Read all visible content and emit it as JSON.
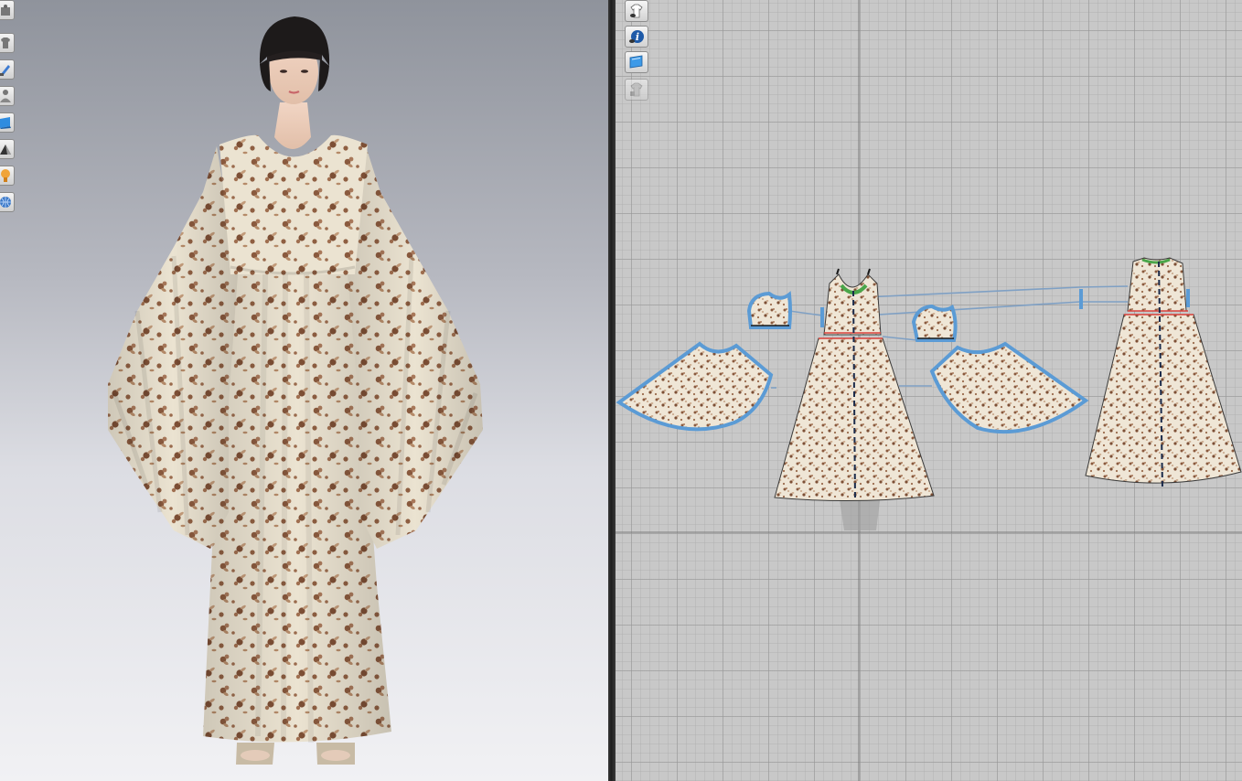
{
  "app": {
    "viewport_3d": {
      "toolbar": [
        {
          "icon": "avatar-display-icon",
          "label": ""
        },
        {
          "icon": "garment-display-icon",
          "label": ""
        },
        {
          "icon": "texture-brush-icon",
          "label": ""
        },
        {
          "icon": "avatar-pose-icon",
          "label": ""
        },
        {
          "icon": "fabric-display-icon",
          "label": ""
        },
        {
          "icon": "render-mode-icon",
          "label": ""
        },
        {
          "icon": "stress-map-icon",
          "label": ""
        },
        {
          "icon": "environment-globe-icon",
          "label": ""
        }
      ],
      "garment": {
        "print_base_color": "#ebe3d1",
        "print_flower_color": "#8a5a3e",
        "print_leaf_color": "#b58a68"
      }
    },
    "viewport_2d": {
      "toolbar": [
        {
          "icon": "garment-visibility-icon",
          "enabled": true
        },
        {
          "icon": "info-icon",
          "enabled": true
        },
        {
          "icon": "fabric-texture-icon",
          "enabled": true
        },
        {
          "icon": "garment-lock-icon",
          "enabled": false
        }
      ],
      "colors": {
        "grid_background": "#c8c8c8",
        "seam_highlight": "#5b9bd5",
        "seam_red": "#d9413b",
        "seam_green": "#4aa64a",
        "grain_line": "#1a2a4a"
      },
      "pattern_pieces": [
        "left-sleeve-cap",
        "right-sleeve-cap",
        "left-sleeve-flare",
        "right-sleeve-flare",
        "front-bodice",
        "front-skirt",
        "back-bodice",
        "back-skirt"
      ]
    }
  }
}
